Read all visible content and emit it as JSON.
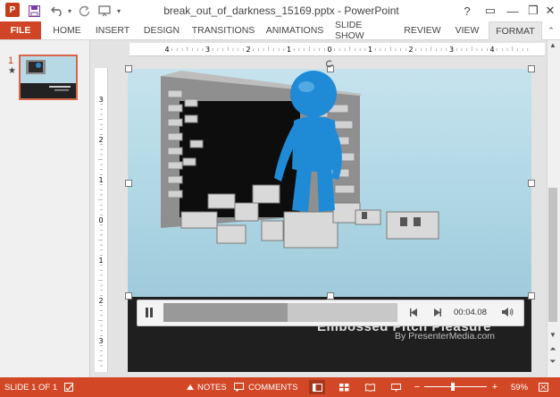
{
  "window": {
    "title": "break_out_of_darkness_15169.pptx - PowerPoint",
    "help_label": "?",
    "minimize_label": "—",
    "restore_label": "❐",
    "close_label": "✕",
    "ribbon_display_label": "▭"
  },
  "qat": {
    "app_logo": "P",
    "save_icon": "save-icon",
    "undo_icon": "undo-icon",
    "redo_icon": "redo-icon",
    "present_icon": "start-from-beginning-icon"
  },
  "ribbon": {
    "tabs": [
      {
        "label": "FILE"
      },
      {
        "label": "HOME"
      },
      {
        "label": "INSERT"
      },
      {
        "label": "DESIGN"
      },
      {
        "label": "TRANSITIONS"
      },
      {
        "label": "ANIMATIONS"
      },
      {
        "label": "SLIDE SHOW"
      },
      {
        "label": "REVIEW"
      },
      {
        "label": "VIEW"
      },
      {
        "label": "FORMAT"
      }
    ]
  },
  "thumbnails": [
    {
      "number": "1",
      "marker": "★"
    }
  ],
  "rulers": {
    "horizontal": [
      "4",
      "3",
      "2",
      "1",
      "0",
      "1",
      "2",
      "3",
      "4"
    ],
    "vertical": [
      "3",
      "2",
      "1",
      "0",
      "1",
      "2",
      "3"
    ]
  },
  "slide": {
    "company_text": "Embossed Pitch Pleasure",
    "by_text": "By PresenterMedia.com"
  },
  "media": {
    "play_icon": "pause-icon",
    "progress": 0.53,
    "back_icon": "skip-back-icon",
    "forward_icon": "skip-forward-icon",
    "time": "00:04.08",
    "volume_icon": "volume-icon"
  },
  "status": {
    "slide_info": "SLIDE 1 OF 1",
    "notes_label": "NOTES",
    "comments_label": "COMMENTS",
    "zoom": "59%",
    "zoom_out": "−",
    "zoom_in": "+"
  },
  "colors": {
    "accent": "#d24726",
    "file_tab": "#d04525",
    "slide_bg": "#b4d9e6"
  }
}
